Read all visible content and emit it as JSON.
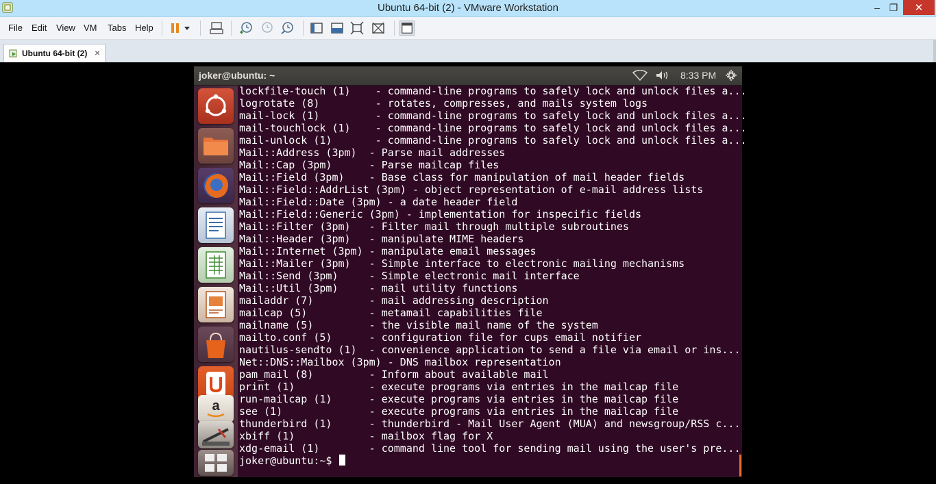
{
  "window": {
    "title": "Ubuntu 64-bit (2) - VMware Workstation",
    "minimize_glyph": "–",
    "maximize_glyph": "❐",
    "close_glyph": "✕"
  },
  "menubar": {
    "items": [
      "File",
      "Edit",
      "View",
      "VM",
      "Tabs",
      "Help"
    ]
  },
  "toolbar": {
    "icons": [
      "pause-icon",
      "dropdown-arrow-icon",
      "send-ctrl-alt-del-icon",
      "snapshot-take-icon",
      "snapshot-revert-icon",
      "snapshot-manager-icon",
      "console-view-icon",
      "quick-switch-icon",
      "fullscreen-icon",
      "unity-icon",
      "library-icon"
    ]
  },
  "tabs": [
    {
      "label": "Ubuntu 64-bit (2)",
      "close": "×"
    }
  ],
  "ubuntu_panel": {
    "window_title": "joker@ubuntu: ~",
    "clock": "8:33 PM",
    "indicators": [
      "wifi-icon",
      "volume-icon",
      "gear-icon"
    ]
  },
  "launcher": {
    "items": [
      "dash-home",
      "files",
      "firefox",
      "libreoffice-writer",
      "libreoffice-calc",
      "libreoffice-impress",
      "software-center",
      "ubuntu-one",
      "amazon",
      "system-settings",
      "workspace-switcher"
    ]
  },
  "terminal": {
    "lines": [
      "lockfile-touch (1)    - command-line programs to safely lock and unlock files a...",
      "logrotate (8)         - rotates, compresses, and mails system logs",
      "mail-lock (1)         - command-line programs to safely lock and unlock files a...",
      "mail-touchlock (1)    - command-line programs to safely lock and unlock files a...",
      "mail-unlock (1)       - command-line programs to safely lock and unlock files a...",
      "Mail::Address (3pm)  - Parse mail addresses",
      "Mail::Cap (3pm)      - Parse mailcap files",
      "Mail::Field (3pm)    - Base class for manipulation of mail header fields",
      "Mail::Field::AddrList (3pm) - object representation of e-mail address lists",
      "Mail::Field::Date (3pm) - a date header field",
      "Mail::Field::Generic (3pm) - implementation for inspecific fields",
      "Mail::Filter (3pm)   - Filter mail through multiple subroutines",
      "Mail::Header (3pm)   - manipulate MIME headers",
      "Mail::Internet (3pm) - manipulate email messages",
      "Mail::Mailer (3pm)   - Simple interface to electronic mailing mechanisms",
      "Mail::Send (3pm)     - Simple electronic mail interface",
      "Mail::Util (3pm)     - mail utility functions",
      "mailaddr (7)         - mail addressing description",
      "mailcap (5)          - metamail capabilities file",
      "mailname (5)         - the visible mail name of the system",
      "mailto.conf (5)      - configuration file for cups email notifier",
      "nautilus-sendto (1)  - convenience application to send a file via email or ins...",
      "Net::DNS::Mailbox (3pm) - DNS mailbox representation",
      "pam_mail (8)         - Inform about available mail",
      "print (1)            - execute programs via entries in the mailcap file",
      "run-mailcap (1)      - execute programs via entries in the mailcap file",
      "see (1)              - execute programs via entries in the mailcap file",
      "thunderbird (1)      - thunderbird - Mail User Agent (MUA) and newsgroup/RSS c...",
      "xbiff (1)            - mailbox flag for X",
      "xdg-email (1)        - command line tool for sending mail using the user's pre..."
    ],
    "prompt": "joker@ubuntu:~$ "
  },
  "colors": {
    "terminal_bg": "#300a24",
    "titlebar_bg": "#b9e3fb",
    "close_button": "#c7362b",
    "ubuntu_orange": "#e46f2a"
  }
}
